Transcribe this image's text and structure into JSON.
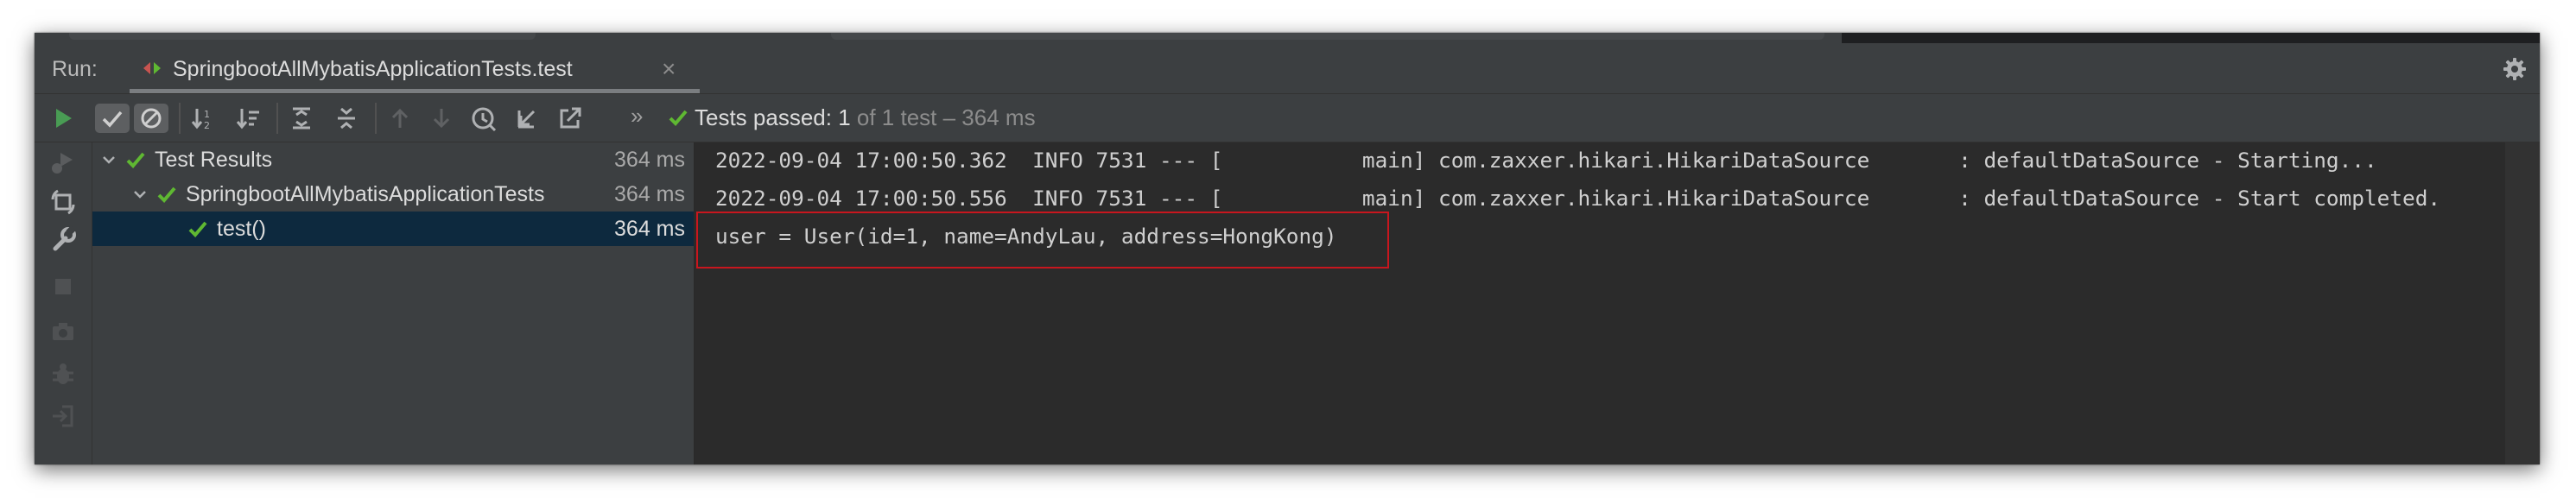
{
  "run_panel": {
    "label": "Run:",
    "tab": {
      "title": "SpringbootAllMybatisApplicationTests.test",
      "close": "×",
      "icon": "run-config-icon"
    },
    "settings_icon": "gear-icon"
  },
  "toolbar": {
    "buttons": [
      "rerun-icon",
      "show-passed-icon",
      "show-ignored-icon",
      "sort-alpha-icon",
      "sort-duration-icon",
      "expand-all-icon",
      "collapse-all-icon",
      "previous-failed-icon",
      "next-failed-icon",
      "test-history-icon",
      "import-tests-icon",
      "export-results-icon"
    ],
    "more": "»",
    "status": {
      "prefix": "Tests passed: ",
      "passed": "1",
      "rest": " of 1 test – 364 ms"
    }
  },
  "side_actions": [
    "rerun-failed-icon",
    "toggle-auto-test-icon",
    "wrench-icon",
    "stop-icon",
    "camera-icon",
    "debug-icon",
    "exit-icon"
  ],
  "tree": {
    "rows": [
      {
        "label": "Test Results",
        "time": "364 ms",
        "expanded": true,
        "status": "passed"
      },
      {
        "label": "SpringbootAllMybatisApplicationTests",
        "time": "364 ms",
        "expanded": true,
        "status": "passed"
      },
      {
        "label": "test()",
        "time": "364 ms",
        "selected": true,
        "status": "passed"
      }
    ]
  },
  "console": {
    "lines": [
      "2022-09-04 17:00:50.362  INFO 7531 --- [           main] com.zaxxer.hikari.HikariDataSource       : defaultDataSource - Starting...",
      "2022-09-04 17:00:50.556  INFO 7531 --- [           main] com.zaxxer.hikari.HikariDataSource       : defaultDataSource - Start completed.",
      "user = User(id=1, name=AndyLau, address=HongKong)"
    ]
  },
  "colors": {
    "panel_bg": "#3c3f41",
    "console_bg": "#2b2b2b",
    "pass_green": "#5fb832",
    "run_green": "#499c54",
    "selection": "#0d293e",
    "highlight_red": "#c8161e"
  }
}
